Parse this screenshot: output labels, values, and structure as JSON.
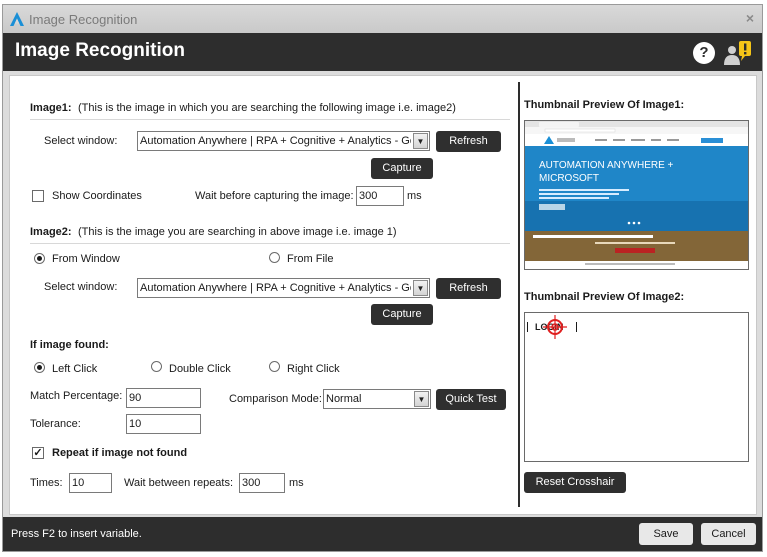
{
  "window": {
    "title": "Image Recognition",
    "close": "×"
  },
  "header": {
    "title": "Image Recognition",
    "help": "?"
  },
  "image1": {
    "heading": "Image1:",
    "description": "(This is the image in which you are searching the following image i.e. image2)",
    "select_window_label": "Select window:",
    "select_window_value": "Automation Anywhere | RPA + Cognitive + Analytics - Google Chrome",
    "refresh": "Refresh",
    "capture": "Capture",
    "show_coordinates": "Show Coordinates",
    "show_coordinates_checked": false,
    "wait_label": "Wait before capturing the image:",
    "wait_value": "300",
    "wait_unit": "ms"
  },
  "image2": {
    "heading": "Image2:",
    "description": "(This is the image you are searching in above image i.e. image 1)",
    "from_window": "From Window",
    "from_file": "From File",
    "source_selected": "From Window",
    "select_window_label": "Select window:",
    "select_window_value": "Automation Anywhere | RPA + Cognitive + Analytics - Google Chrome",
    "refresh": "Refresh",
    "capture": "Capture"
  },
  "found": {
    "heading": "If image found:",
    "left_click": "Left Click",
    "double_click": "Double Click",
    "right_click": "Right Click",
    "selected": "Left Click",
    "match_label": "Match Percentage:",
    "match_value": "90",
    "tolerance_label": "Tolerance:",
    "tolerance_value": "10",
    "comparison_label": "Comparison Mode:",
    "comparison_value": "Normal",
    "quick_test": "Quick Test"
  },
  "repeat": {
    "label": "Repeat if image not found",
    "checked": true,
    "check_glyph": "✓",
    "times_label": "Times:",
    "times_value": "10",
    "wait_label": "Wait between repeats:",
    "wait_value": "300",
    "wait_unit": "ms"
  },
  "preview": {
    "thumb1_title": "Thumbnail Preview Of Image1:",
    "thumb1_banner_line1": "AUTOMATION ANYWHERE +",
    "thumb1_banner_line2": "MICROSOFT",
    "thumb2_title": "Thumbnail Preview Of Image2:",
    "thumb2_text": "LOGIN",
    "reset_crosshair": "Reset Crosshair"
  },
  "footer": {
    "hint": "Press F2 to insert variable.",
    "save": "Save",
    "cancel": "Cancel"
  },
  "colors": {
    "header_bg": "#2d2d2d",
    "button_bg": "#2f2f2f",
    "alert_yellow": "#f5c518",
    "brand_blue": "#1a8fd6",
    "crosshair_red": "#e01f1f"
  },
  "icons": [
    "automation-anywhere-logo-icon",
    "close-icon",
    "help-icon",
    "user-alert-icon",
    "dropdown-arrow-icon",
    "crosshair-icon"
  ]
}
